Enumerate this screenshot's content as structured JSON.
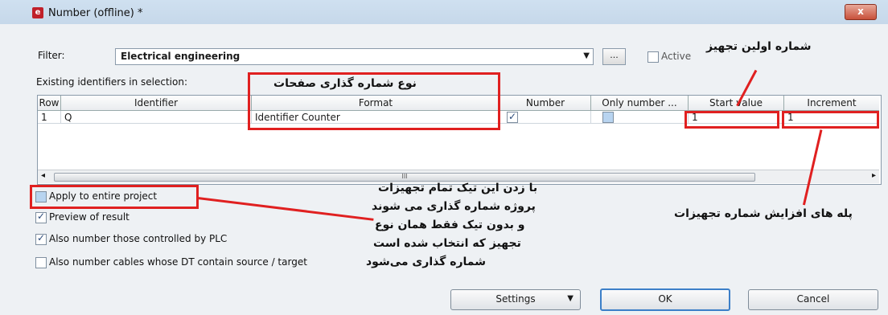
{
  "window": {
    "title": "Number (offline) *",
    "close_label": "x"
  },
  "filter": {
    "label": "Filter:",
    "value": "Electrical engineering",
    "more_label": "...",
    "active_label": "Active"
  },
  "grid": {
    "caption": "Existing identifiers in selection:",
    "columns": [
      "Row",
      "Identifier",
      "Format",
      "Number",
      "Only number ...",
      "Start value",
      "Increment"
    ],
    "rows": [
      {
        "row": "1",
        "identifier": "Q",
        "format": "Identifier Counter",
        "start": "1",
        "increment": "1"
      }
    ],
    "scroll_marker": "III"
  },
  "options": {
    "apply_entire": "Apply to entire project",
    "preview": "Preview of result",
    "plc": "Also number those controlled by PLC",
    "cables": "Also number cables whose DT contain source / target"
  },
  "buttons": {
    "settings": "Settings",
    "ok": "OK",
    "cancel": "Cancel"
  },
  "annotations": {
    "format_note": "نوع شماره گذاری صفحات",
    "start_note": "شماره اولین تجهیز",
    "increment_note": "پله های افزایش شماره تجهیزات",
    "apply_line1": "با زدن این تیک تمام تجهیزات",
    "apply_line2": "پروژه شماره گذاری می شوند",
    "apply_line3": "و بدون تیک فقط همان نوع",
    "apply_line4": "تجهیز که انتخاب شده است",
    "apply_line5": "شماره گذاری می‌شود"
  },
  "colors": {
    "annotation_red": "#e02020",
    "ok_border": "#3c7fc8"
  }
}
